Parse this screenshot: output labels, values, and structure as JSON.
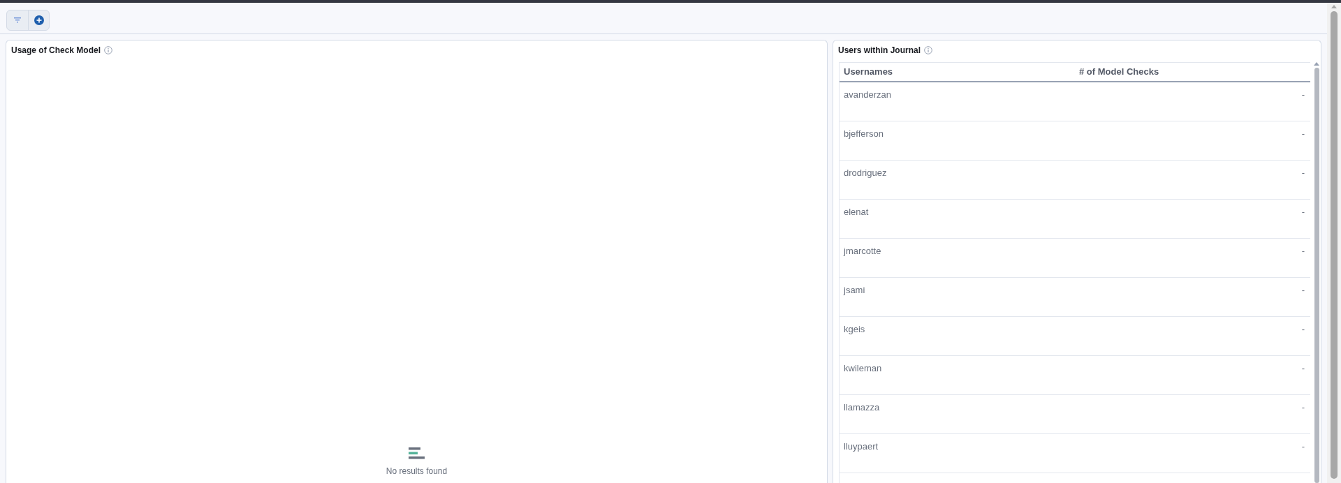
{
  "left_panel": {
    "title": "Usage of Check Model",
    "empty_message": "No results found"
  },
  "right_panel": {
    "title": "Users within Journal",
    "table": {
      "columns": [
        "Usernames",
        "# of Model Checks"
      ],
      "rows": [
        {
          "username": "avanderzan",
          "checks": "-"
        },
        {
          "username": "bjefferson",
          "checks": "-"
        },
        {
          "username": "drodriguez",
          "checks": "-"
        },
        {
          "username": "elenat",
          "checks": "-"
        },
        {
          "username": "jmarcotte",
          "checks": "-"
        },
        {
          "username": "jsami",
          "checks": "-"
        },
        {
          "username": "kgeis",
          "checks": "-"
        },
        {
          "username": "kwileman",
          "checks": "-"
        },
        {
          "username": "llamazza",
          "checks": "-"
        },
        {
          "username": "lluypaert",
          "checks": "-"
        }
      ]
    }
  }
}
